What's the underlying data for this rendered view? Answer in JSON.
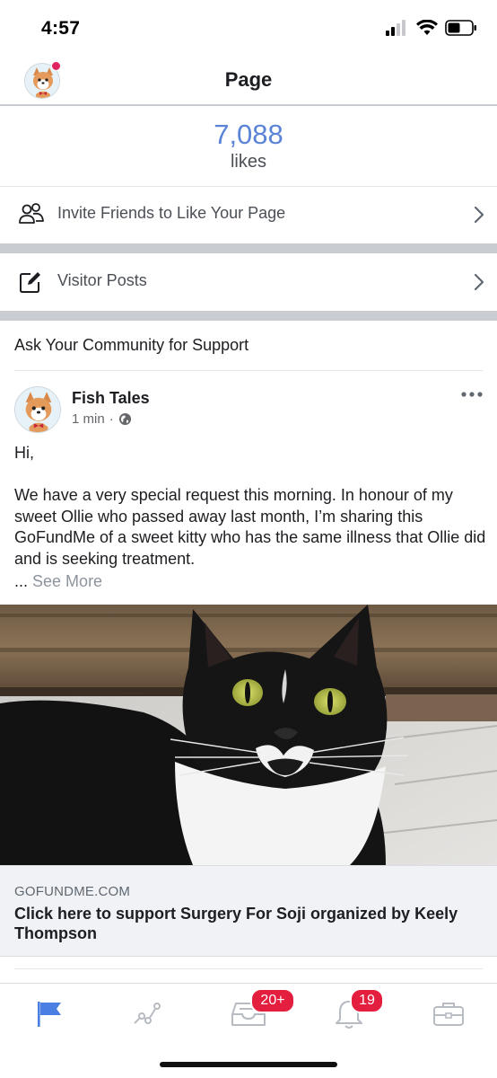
{
  "status_bar": {
    "time": "4:57",
    "signal_icon": "cellular-signal-icon",
    "wifi_icon": "wifi-icon",
    "battery_icon": "battery-icon"
  },
  "nav": {
    "title": "Page",
    "avatar_icon": "corgi-avatar-icon"
  },
  "likes": {
    "count": "7,088",
    "label": "likes"
  },
  "rows": {
    "invite": {
      "label": "Invite Friends to Like Your Page",
      "icon": "people-icon"
    },
    "visitor": {
      "label": "Visitor Posts",
      "icon": "compose-icon"
    }
  },
  "section": {
    "title": "Ask Your Community for Support"
  },
  "post": {
    "author": "Fish Tales",
    "time": "1 min",
    "dot": "·",
    "greeting": "Hi,",
    "body": "We have a very special request this morning. In honour of my sweet Ollie who passed away last month, I’m sharing this GoFundMe of a sweet kitty who has the same illness that Ollie did and is seeking treatment.",
    "ellipsis": "...",
    "see_more": "See More"
  },
  "link": {
    "domain": "GOFUNDME.COM",
    "title": "Click here to support Surgery For Soji organized by Keely Thompson"
  },
  "tabs": [
    {
      "name": "flag-icon",
      "active": true
    },
    {
      "name": "insights-icon",
      "active": false
    },
    {
      "name": "inbox-icon",
      "active": false,
      "badge": "20+"
    },
    {
      "name": "bell-icon",
      "active": false,
      "badge": "19"
    },
    {
      "name": "briefcase-icon",
      "active": false
    }
  ],
  "colors": {
    "accent": "#5b83d6",
    "badge": "#e41e3f",
    "tab_active": "#4a7ee3",
    "tab_inactive": "#b7bcc3"
  }
}
